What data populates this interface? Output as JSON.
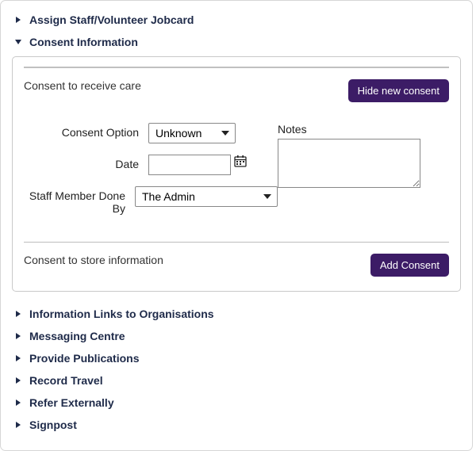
{
  "accordions": {
    "assign_staff": "Assign Staff/Volunteer Jobcard",
    "consent_info": "Consent Information",
    "info_links": "Information Links to Organisations",
    "messaging": "Messaging Centre",
    "publications": "Provide Publications",
    "record_travel": "Record Travel",
    "refer_ext": "Refer Externally",
    "signpost": "Signpost"
  },
  "consent_panel": {
    "section1_title": "Consent to receive care",
    "hide_btn": "Hide new consent",
    "labels": {
      "consent_option": "Consent Option",
      "date": "Date",
      "staff_done_by": "Staff Member Done By",
      "notes": "Notes"
    },
    "consent_option_value": "Unknown",
    "date_value": "",
    "staff_done_by_value": "The Admin",
    "notes_value": "",
    "section2_title": "Consent to store information",
    "add_btn": "Add Consent"
  }
}
